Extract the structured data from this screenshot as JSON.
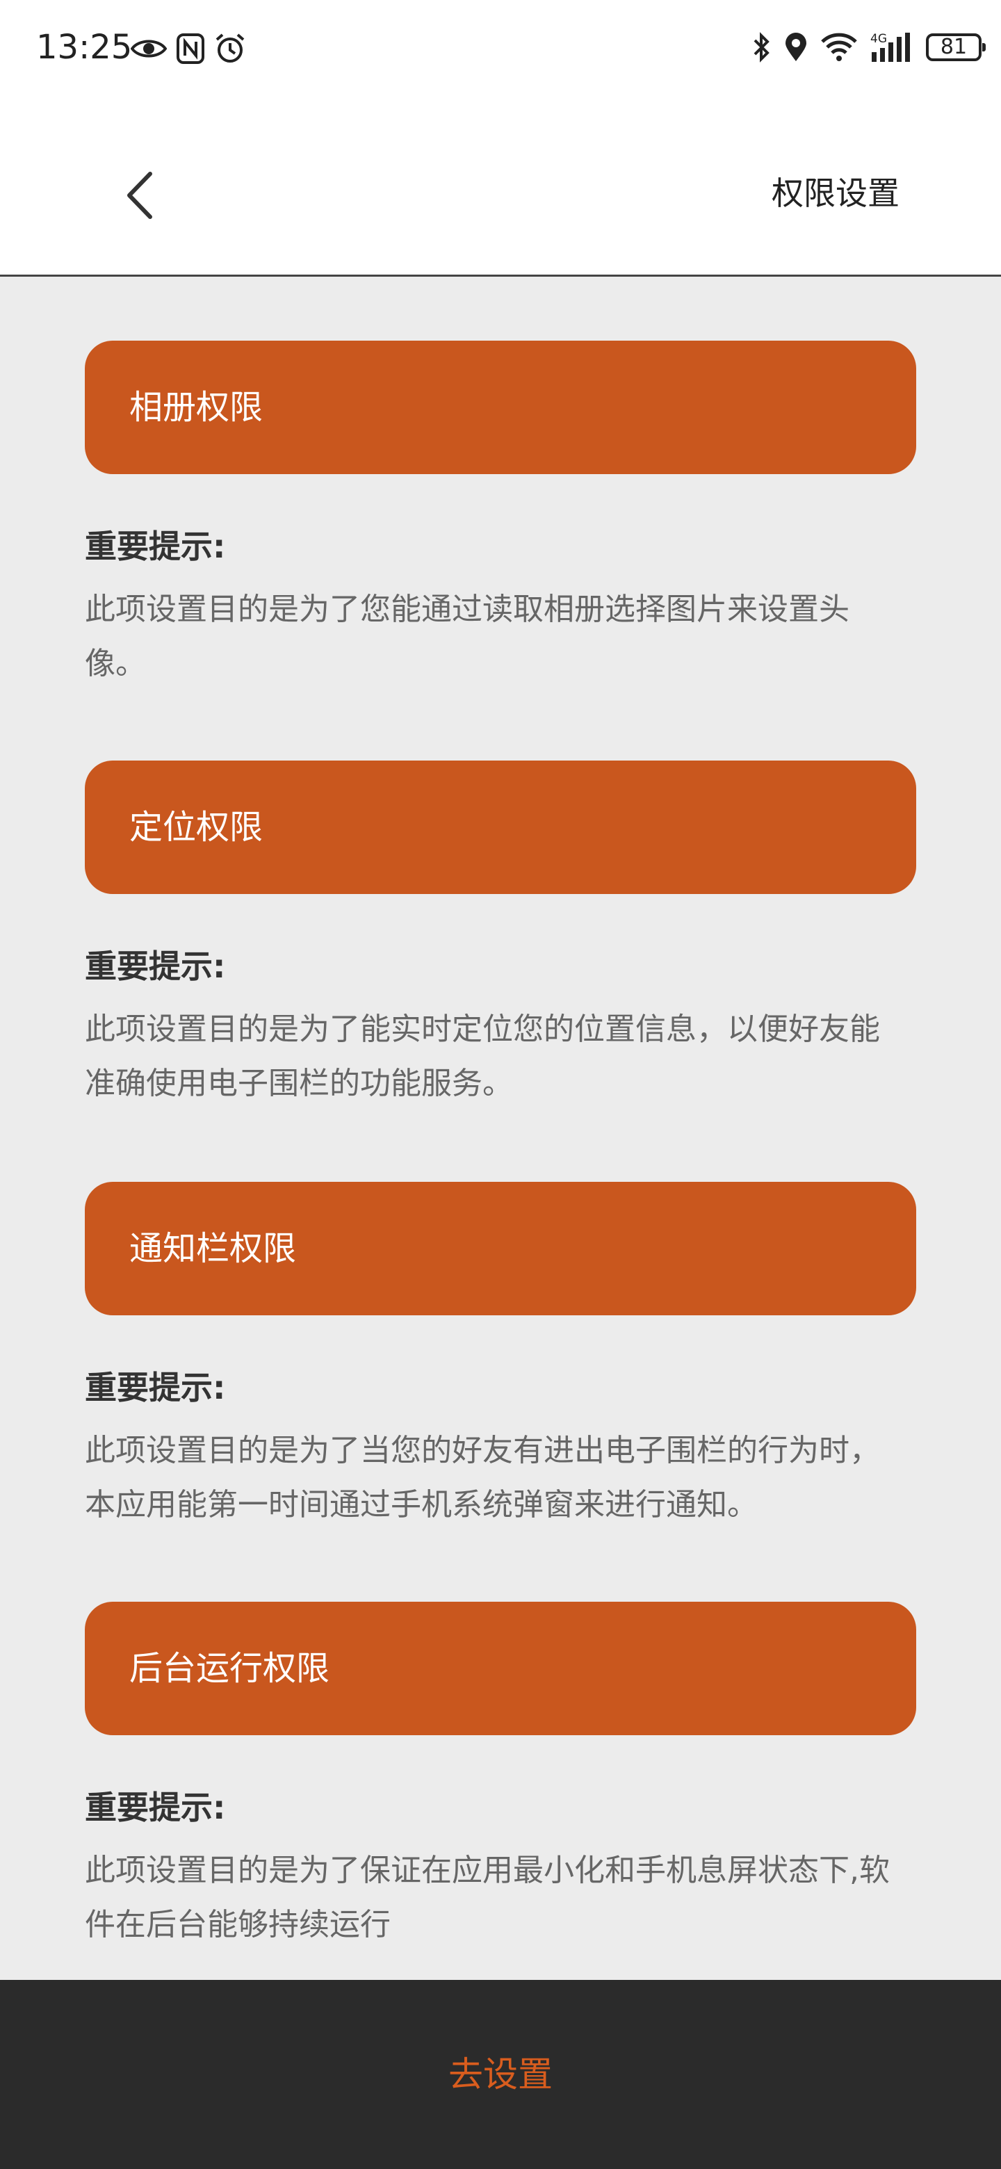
{
  "status_bar": {
    "time": "13:25",
    "battery": "81",
    "left_icons": [
      "eye-icon",
      "nfc-icon",
      "alarm-icon"
    ],
    "right_icons": [
      "bluetooth-icon",
      "location-icon",
      "wifi-icon",
      "signal-4g-icon",
      "battery-icon"
    ]
  },
  "header": {
    "back_icon": "chevron-left-icon",
    "title": "权限设置"
  },
  "sections": [
    {
      "button_label": "相册权限",
      "tip_title": "重要提示:",
      "tip_text": "此项设置目的是为了您能通过读取相册选择图片来设置头像。"
    },
    {
      "button_label": "定位权限",
      "tip_title": "重要提示:",
      "tip_text": "此项设置目的是为了能实时定位您的位置信息，以便好友能准确使用电子围栏的功能服务。"
    },
    {
      "button_label": "通知栏权限",
      "tip_title": "重要提示:",
      "tip_text": "此项设置目的是为了当您的好友有进出电子围栏的行为时，本应用能第一时间通过手机系统弹窗来进行通知。"
    },
    {
      "button_label": "后台运行权限",
      "tip_title": "重要提示:",
      "tip_text": "此项设置目的是为了保证在应用最小化和手机息屏状态下,软件在后台能够持续运行"
    }
  ],
  "bottom_bar": {
    "label": "去设置"
  },
  "colors": {
    "accent": "#c9571e",
    "bottom_bar_bg": "#2b2b2b",
    "bottom_label": "#d95d1e",
    "page_bg": "#ececec"
  }
}
